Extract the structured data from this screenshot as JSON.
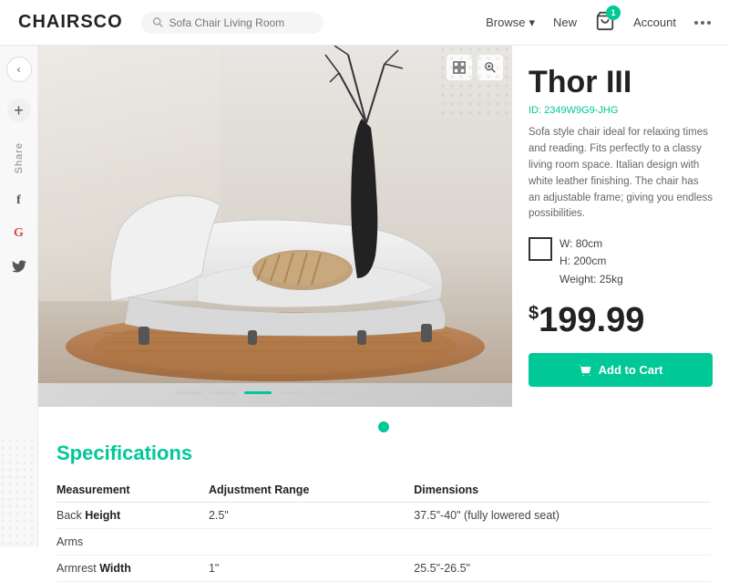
{
  "header": {
    "logo": "CHAIRSCO",
    "search_placeholder": "Sofa Chair Living Room",
    "nav": {
      "browse": "Browse",
      "new": "New",
      "account": "Account"
    },
    "cart_count": "1"
  },
  "sidebar": {
    "share_label": "Share",
    "plus_icon": "+",
    "arrow_icon": "‹",
    "social": [
      "f",
      "G",
      "𝕏"
    ]
  },
  "product": {
    "title": "Thor III",
    "id": "ID: 2349W9G9-JHG",
    "description": "Sofa style chair ideal for relaxing times and reading. Fits perfectly to a classy living room space. Italian design with white leather finishing. The chair has an adjustable frame; giving you endless possibilities.",
    "dimensions": {
      "width": "W: 80cm",
      "height": "H: 200cm",
      "weight": "Weight: 25kg"
    },
    "price": "199.99",
    "price_currency": "$",
    "add_to_cart": "Add to Cart"
  },
  "image": {
    "dots": [
      {
        "active": false
      },
      {
        "active": false
      },
      {
        "active": true
      },
      {
        "active": false
      },
      {
        "active": false
      },
      {
        "active": false
      }
    ]
  },
  "specs": {
    "title": "Specifications",
    "columns": [
      "Measurement",
      "Adjustment Range",
      "Dimensions"
    ],
    "rows": [
      {
        "measurement_plain": "Back ",
        "measurement_bold": "Height",
        "range": "2.5\"",
        "dimensions": "37.5\"-40\" (fully lowered seat)"
      },
      {
        "measurement_plain": "Arms",
        "measurement_bold": "",
        "range": "",
        "dimensions": ""
      },
      {
        "measurement_plain": "Armrest ",
        "measurement_bold": "Width",
        "range": "1\"",
        "dimensions": "25.5\"-26.5\""
      }
    ]
  },
  "icons": {
    "cart": "🛒",
    "search": "🔍",
    "image_gallery": "⊞",
    "zoom": "⊕",
    "chevron_down": "▾",
    "close": "×"
  }
}
